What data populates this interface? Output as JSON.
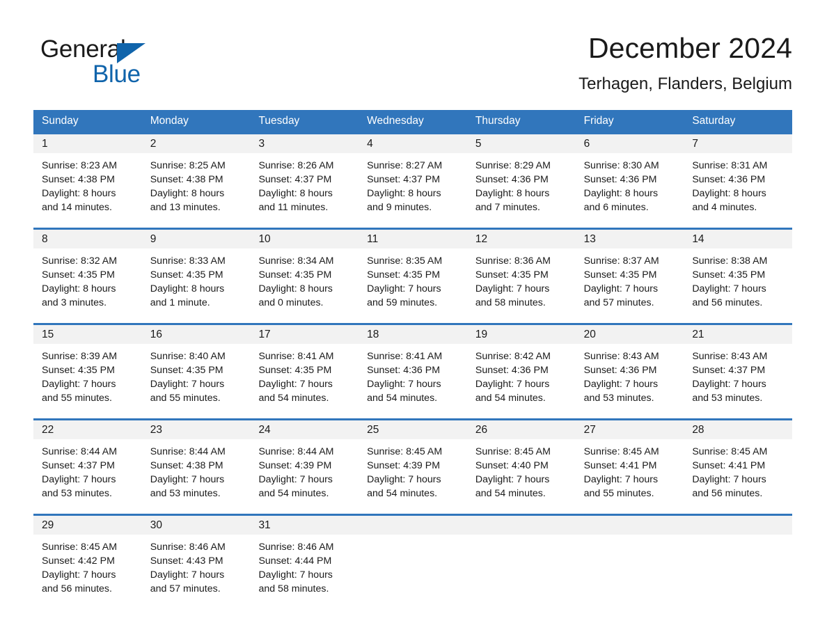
{
  "brand": {
    "name_part1": "General",
    "name_part2": "Blue",
    "triangle_color": "#1064ab",
    "blue_color": "#1064ab"
  },
  "header": {
    "title": "December 2024",
    "subtitle": "Terhagen, Flanders, Belgium"
  },
  "theme": {
    "header_blue": "#3176bc",
    "daynum_band": "#f2f2f2",
    "text": "#1a1a1a"
  },
  "weekdays": [
    "Sunday",
    "Monday",
    "Tuesday",
    "Wednesday",
    "Thursday",
    "Friday",
    "Saturday"
  ],
  "weeks": [
    {
      "numbers": [
        "1",
        "2",
        "3",
        "4",
        "5",
        "6",
        "7"
      ],
      "cells": [
        {
          "sunrise": "Sunrise: 8:23 AM",
          "sunset": "Sunset: 4:38 PM",
          "daylight1": "Daylight: 8 hours",
          "daylight2": "and 14 minutes."
        },
        {
          "sunrise": "Sunrise: 8:25 AM",
          "sunset": "Sunset: 4:38 PM",
          "daylight1": "Daylight: 8 hours",
          "daylight2": "and 13 minutes."
        },
        {
          "sunrise": "Sunrise: 8:26 AM",
          "sunset": "Sunset: 4:37 PM",
          "daylight1": "Daylight: 8 hours",
          "daylight2": "and 11 minutes."
        },
        {
          "sunrise": "Sunrise: 8:27 AM",
          "sunset": "Sunset: 4:37 PM",
          "daylight1": "Daylight: 8 hours",
          "daylight2": "and 9 minutes."
        },
        {
          "sunrise": "Sunrise: 8:29 AM",
          "sunset": "Sunset: 4:36 PM",
          "daylight1": "Daylight: 8 hours",
          "daylight2": "and 7 minutes."
        },
        {
          "sunrise": "Sunrise: 8:30 AM",
          "sunset": "Sunset: 4:36 PM",
          "daylight1": "Daylight: 8 hours",
          "daylight2": "and 6 minutes."
        },
        {
          "sunrise": "Sunrise: 8:31 AM",
          "sunset": "Sunset: 4:36 PM",
          "daylight1": "Daylight: 8 hours",
          "daylight2": "and 4 minutes."
        }
      ]
    },
    {
      "numbers": [
        "8",
        "9",
        "10",
        "11",
        "12",
        "13",
        "14"
      ],
      "cells": [
        {
          "sunrise": "Sunrise: 8:32 AM",
          "sunset": "Sunset: 4:35 PM",
          "daylight1": "Daylight: 8 hours",
          "daylight2": "and 3 minutes."
        },
        {
          "sunrise": "Sunrise: 8:33 AM",
          "sunset": "Sunset: 4:35 PM",
          "daylight1": "Daylight: 8 hours",
          "daylight2": "and 1 minute."
        },
        {
          "sunrise": "Sunrise: 8:34 AM",
          "sunset": "Sunset: 4:35 PM",
          "daylight1": "Daylight: 8 hours",
          "daylight2": "and 0 minutes."
        },
        {
          "sunrise": "Sunrise: 8:35 AM",
          "sunset": "Sunset: 4:35 PM",
          "daylight1": "Daylight: 7 hours",
          "daylight2": "and 59 minutes."
        },
        {
          "sunrise": "Sunrise: 8:36 AM",
          "sunset": "Sunset: 4:35 PM",
          "daylight1": "Daylight: 7 hours",
          "daylight2": "and 58 minutes."
        },
        {
          "sunrise": "Sunrise: 8:37 AM",
          "sunset": "Sunset: 4:35 PM",
          "daylight1": "Daylight: 7 hours",
          "daylight2": "and 57 minutes."
        },
        {
          "sunrise": "Sunrise: 8:38 AM",
          "sunset": "Sunset: 4:35 PM",
          "daylight1": "Daylight: 7 hours",
          "daylight2": "and 56 minutes."
        }
      ]
    },
    {
      "numbers": [
        "15",
        "16",
        "17",
        "18",
        "19",
        "20",
        "21"
      ],
      "cells": [
        {
          "sunrise": "Sunrise: 8:39 AM",
          "sunset": "Sunset: 4:35 PM",
          "daylight1": "Daylight: 7 hours",
          "daylight2": "and 55 minutes."
        },
        {
          "sunrise": "Sunrise: 8:40 AM",
          "sunset": "Sunset: 4:35 PM",
          "daylight1": "Daylight: 7 hours",
          "daylight2": "and 55 minutes."
        },
        {
          "sunrise": "Sunrise: 8:41 AM",
          "sunset": "Sunset: 4:35 PM",
          "daylight1": "Daylight: 7 hours",
          "daylight2": "and 54 minutes."
        },
        {
          "sunrise": "Sunrise: 8:41 AM",
          "sunset": "Sunset: 4:36 PM",
          "daylight1": "Daylight: 7 hours",
          "daylight2": "and 54 minutes."
        },
        {
          "sunrise": "Sunrise: 8:42 AM",
          "sunset": "Sunset: 4:36 PM",
          "daylight1": "Daylight: 7 hours",
          "daylight2": "and 54 minutes."
        },
        {
          "sunrise": "Sunrise: 8:43 AM",
          "sunset": "Sunset: 4:36 PM",
          "daylight1": "Daylight: 7 hours",
          "daylight2": "and 53 minutes."
        },
        {
          "sunrise": "Sunrise: 8:43 AM",
          "sunset": "Sunset: 4:37 PM",
          "daylight1": "Daylight: 7 hours",
          "daylight2": "and 53 minutes."
        }
      ]
    },
    {
      "numbers": [
        "22",
        "23",
        "24",
        "25",
        "26",
        "27",
        "28"
      ],
      "cells": [
        {
          "sunrise": "Sunrise: 8:44 AM",
          "sunset": "Sunset: 4:37 PM",
          "daylight1": "Daylight: 7 hours",
          "daylight2": "and 53 minutes."
        },
        {
          "sunrise": "Sunrise: 8:44 AM",
          "sunset": "Sunset: 4:38 PM",
          "daylight1": "Daylight: 7 hours",
          "daylight2": "and 53 minutes."
        },
        {
          "sunrise": "Sunrise: 8:44 AM",
          "sunset": "Sunset: 4:39 PM",
          "daylight1": "Daylight: 7 hours",
          "daylight2": "and 54 minutes."
        },
        {
          "sunrise": "Sunrise: 8:45 AM",
          "sunset": "Sunset: 4:39 PM",
          "daylight1": "Daylight: 7 hours",
          "daylight2": "and 54 minutes."
        },
        {
          "sunrise": "Sunrise: 8:45 AM",
          "sunset": "Sunset: 4:40 PM",
          "daylight1": "Daylight: 7 hours",
          "daylight2": "and 54 minutes."
        },
        {
          "sunrise": "Sunrise: 8:45 AM",
          "sunset": "Sunset: 4:41 PM",
          "daylight1": "Daylight: 7 hours",
          "daylight2": "and 55 minutes."
        },
        {
          "sunrise": "Sunrise: 8:45 AM",
          "sunset": "Sunset: 4:41 PM",
          "daylight1": "Daylight: 7 hours",
          "daylight2": "and 56 minutes."
        }
      ]
    },
    {
      "numbers": [
        "29",
        "30",
        "31",
        "",
        "",
        "",
        ""
      ],
      "cells": [
        {
          "sunrise": "Sunrise: 8:45 AM",
          "sunset": "Sunset: 4:42 PM",
          "daylight1": "Daylight: 7 hours",
          "daylight2": "and 56 minutes."
        },
        {
          "sunrise": "Sunrise: 8:46 AM",
          "sunset": "Sunset: 4:43 PM",
          "daylight1": "Daylight: 7 hours",
          "daylight2": "and 57 minutes."
        },
        {
          "sunrise": "Sunrise: 8:46 AM",
          "sunset": "Sunset: 4:44 PM",
          "daylight1": "Daylight: 7 hours",
          "daylight2": "and 58 minutes."
        },
        {
          "sunrise": "",
          "sunset": "",
          "daylight1": "",
          "daylight2": ""
        },
        {
          "sunrise": "",
          "sunset": "",
          "daylight1": "",
          "daylight2": ""
        },
        {
          "sunrise": "",
          "sunset": "",
          "daylight1": "",
          "daylight2": ""
        },
        {
          "sunrise": "",
          "sunset": "",
          "daylight1": "",
          "daylight2": ""
        }
      ]
    }
  ]
}
